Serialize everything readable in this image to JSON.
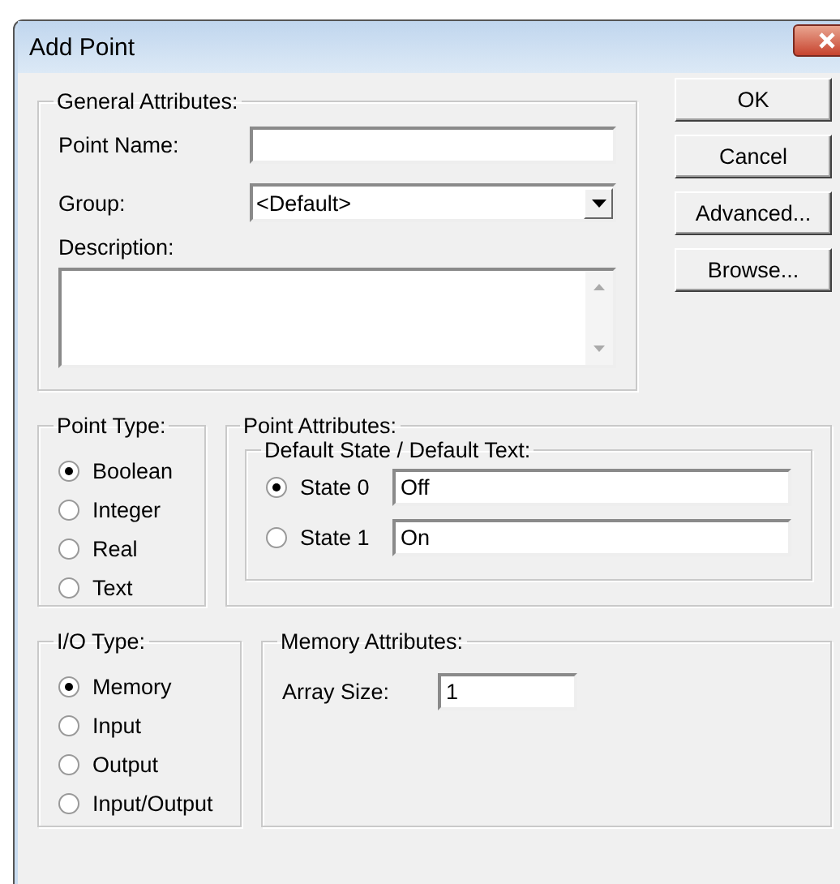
{
  "window": {
    "title": "Add Point"
  },
  "general": {
    "title": "General Attributes:",
    "point_name": {
      "label": "Point Name:"
    },
    "group": {
      "label": "Group:",
      "value": "<Default>"
    },
    "description": {
      "label": "Description:"
    }
  },
  "buttons": [
    "OK",
    "Cancel",
    "Advanced...",
    "Browse..."
  ],
  "point_type": {
    "title": "Point Type:",
    "options": [
      {
        "label": "Boolean",
        "selected": true
      },
      {
        "label": "Integer",
        "selected": false
      },
      {
        "label": "Real",
        "selected": false
      },
      {
        "label": "Text",
        "selected": false
      }
    ]
  },
  "point_attributes": {
    "title": "Point Attributes:",
    "default_state": {
      "title": "Default State / Default Text:",
      "states": [
        {
          "label": "State 0",
          "selected": true,
          "value": "Off"
        },
        {
          "label": "State 1",
          "selected": false,
          "value": "On"
        }
      ]
    }
  },
  "io_type": {
    "title": "I/O Type:",
    "options": [
      {
        "label": "Memory",
        "selected": true
      },
      {
        "label": "Input",
        "selected": false
      },
      {
        "label": "Output",
        "selected": false
      },
      {
        "label": "Input/Output",
        "selected": false
      }
    ]
  },
  "memory_attributes": {
    "title": "Memory Attributes:",
    "array_size": {
      "label": "Array Size:",
      "value": "1"
    }
  }
}
